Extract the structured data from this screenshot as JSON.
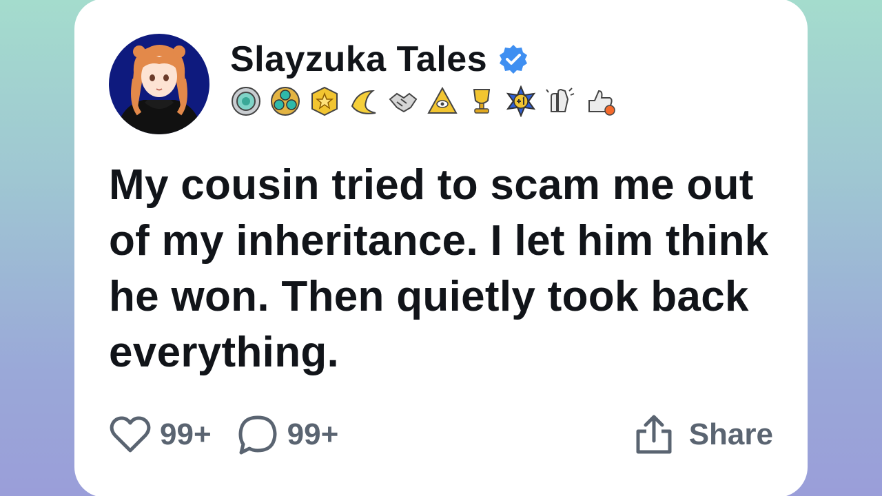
{
  "post": {
    "author": {
      "name": "Slayzuka Tales",
      "verified": true,
      "avatar_icon": "anime-girl-avatar"
    },
    "badges": [
      "silver-medal-icon",
      "gem-cluster-icon",
      "gold-star-icon",
      "banana-icon",
      "handshake-icon",
      "pyramid-eye-icon",
      "gold-trophy-icon",
      "plus-one-icon",
      "clapping-hands-icon",
      "thumbs-up-rocket-icon"
    ],
    "text": "My cousin tried to scam me out of my inheritance. I let him think he won. Then quietly took back everything.",
    "likes": "99+",
    "comments": "99+",
    "share_label": "Share"
  },
  "colors": {
    "verified": "#3f8ff1",
    "text": "#111419",
    "muted": "#5a6471"
  }
}
